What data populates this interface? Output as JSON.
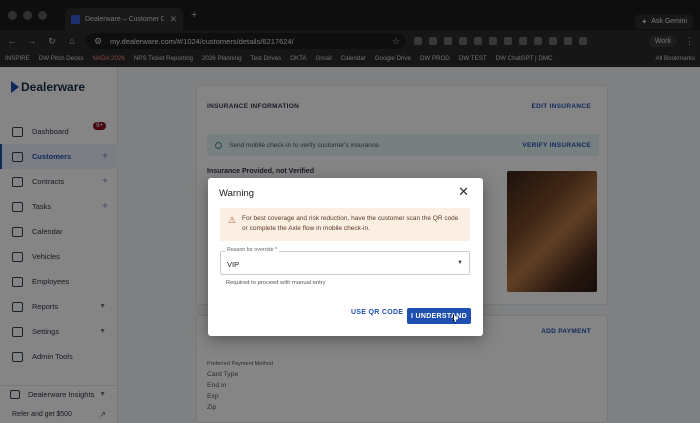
{
  "browser": {
    "tab_title": "Dealerware – Customer Detai",
    "url": "my.dealerware.com/#/1024/customers/details/6217624/",
    "gemini_label": "Ask Gemini",
    "profile_label": "Work",
    "bookmarks": [
      "INSPIRE",
      "DW Pitch Decks",
      "NADA 2026",
      "NPS Ticket Reporting",
      "2026 Planning",
      "Test Drives",
      "OKTA",
      "Gmail",
      "Calendar",
      "Google Drive",
      "DW PROD",
      "DW TEST",
      "DW ChatGPT | DMC",
      "All Bookmarks"
    ]
  },
  "sidebar": {
    "logo": "Dealerware",
    "items": [
      {
        "label": "Dashboard",
        "badge": "9+"
      },
      {
        "label": "Customers"
      },
      {
        "label": "Contracts"
      },
      {
        "label": "Tasks"
      },
      {
        "label": "Calendar"
      },
      {
        "label": "Vehicles"
      },
      {
        "label": "Employees"
      },
      {
        "label": "Reports"
      },
      {
        "label": "Settings"
      },
      {
        "label": "Admin Tools"
      }
    ],
    "insights_label": "Dealerware Insights",
    "refer_label": "Refer and get $500"
  },
  "insurance": {
    "heading": "INSURANCE INFORMATION",
    "edit_label": "EDIT INSURANCE",
    "info_text": "Send mobile check-in to verify customer's insurance.",
    "verify_label": "VERIFY INSURANCE",
    "status_text": "Insurance Provided, not Verified"
  },
  "payment": {
    "add_label": "ADD PAYMENT",
    "fields": [
      "Preferred Payment Method",
      "Card Type",
      "End in",
      "Exp",
      "Zip"
    ]
  },
  "modal": {
    "title": "Warning",
    "warning_text": "For best coverage and risk reduction, have the customer scan the QR code or complete the Axle flow in mobile check-in.",
    "select_label": "Reason for override *",
    "select_value": "VIP",
    "helper_text": "Required to proceed with manual entry",
    "secondary_button": "USE QR CODE",
    "primary_button": "I UNDERSTAND"
  }
}
